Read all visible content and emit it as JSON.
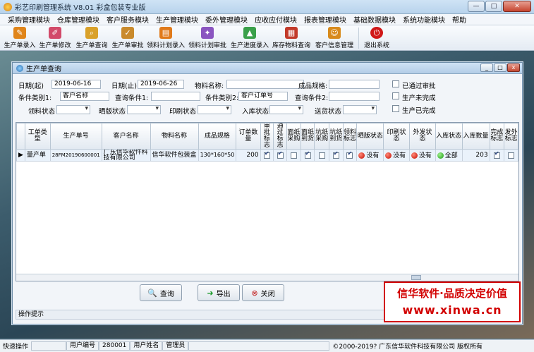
{
  "app": {
    "title": "彩艺印刷管理系统  V8.01 彩盒包装专业版",
    "btn_min": "—",
    "btn_max": "□",
    "btn_close": "✕"
  },
  "menu": [
    "采购管理模块",
    "仓库管理模块",
    "客户服务模块",
    "生产管理模块",
    "委外管理模块",
    "应收应付模块",
    "报表管理模块",
    "基础数据模块",
    "系统功能模块",
    "帮助"
  ],
  "toolbar": [
    {
      "label": "生产单录入",
      "icon": "production-entry-icon",
      "color": "#e0851a",
      "glyph": "✎"
    },
    {
      "label": "生产单修改",
      "icon": "production-edit-icon",
      "color": "#d24a6a",
      "glyph": "✐"
    },
    {
      "label": "生产单查询",
      "icon": "production-query-icon",
      "color": "#d9a12a",
      "glyph": "⌕"
    },
    {
      "label": "生产单审批",
      "icon": "production-approve-icon",
      "color": "#c98a2c",
      "glyph": "✓"
    },
    {
      "label": "领料计划录入",
      "icon": "material-plan-entry-icon",
      "color": "#e07a1a",
      "glyph": "▤"
    },
    {
      "label": "领料计划审批",
      "icon": "material-plan-approve-icon",
      "color": "#8a55c0",
      "glyph": "✦"
    },
    {
      "label": "生产进度录入",
      "icon": "progress-entry-icon",
      "color": "#3aa04a",
      "glyph": "▲"
    },
    {
      "label": "库存物料查询",
      "icon": "stock-query-icon",
      "color": "#c23a2a",
      "glyph": "▦"
    },
    {
      "label": "客户信息管理",
      "icon": "customer-info-icon",
      "color": "#d88a1c",
      "glyph": "☺"
    },
    {
      "label": "退出系统",
      "icon": "exit-icon",
      "color": "#d01818",
      "glyph": "⏻"
    }
  ],
  "window": {
    "title": "生产单查询",
    "btn_min": "_",
    "btn_max": "□",
    "btn_close": "x"
  },
  "filters": {
    "date_from_label": "日期(起)",
    "date_from": "2019-06-16",
    "date_to_label": "日期(止)",
    "date_to": "2019-06-26",
    "material_name_label": "物料名称:",
    "material_name": "",
    "product_spec_label": "成品规格:",
    "product_spec": "",
    "cat1_label": "条件类别1:",
    "cat1": "客户名称",
    "query1_label": "查询条件1:",
    "query1": "",
    "cat2_label": "条件类别2:",
    "cat2": "客户订单号",
    "query2_label": "查询条件2:",
    "query2": "",
    "pick_status_label": "领料状态",
    "pick_status": "",
    "sun_status_label": "晒版状态",
    "sun_status": "",
    "print_status_label": "印刷状态",
    "print_status": "",
    "instock_status_label": "入库状态",
    "instock_status": "",
    "ship_status_label": "送货状态",
    "ship_status": "",
    "chk_approved": "已通过审批",
    "chk_unfinished": "生产未完成",
    "chk_finished": "生产已完成"
  },
  "table": {
    "columns": [
      "工单类型",
      "生产单号",
      "客户名称",
      "物料名称",
      "成品规格",
      "订单数量",
      "审批标志",
      "通过标志",
      "面纸采购",
      "面纸到货",
      "坑纸采购",
      "坑纸到货",
      "领料标志",
      "晒版状态",
      "印刷状态",
      "外发状态",
      "入库状态",
      "入库数量",
      "完成标志",
      "发外标志"
    ],
    "row": {
      "type": "量产单",
      "no": "28FM20190600001",
      "customer": "广东信华软件科技有限公司",
      "material": "信华软件包装盒",
      "spec": "130*160*50",
      "qty": "200",
      "sun": "没有",
      "print": "没有",
      "out": "没有",
      "instock": "全部",
      "instock_qty": "203"
    }
  },
  "buttons": {
    "query": "查询",
    "export": "导出",
    "close": "关闭"
  },
  "hint": "操作提示",
  "status": {
    "quick": "快速操作",
    "user_no_label": "用户编号",
    "user_no": "280001",
    "user_name_label": "用户姓名",
    "user_name": "管理员",
    "copyright": "©2000-2019?   广东信华软件科技有限公司    版权所有"
  },
  "banner": {
    "line1": "信华软件·品质决定价值",
    "line2": "www.xinwa.cn"
  }
}
